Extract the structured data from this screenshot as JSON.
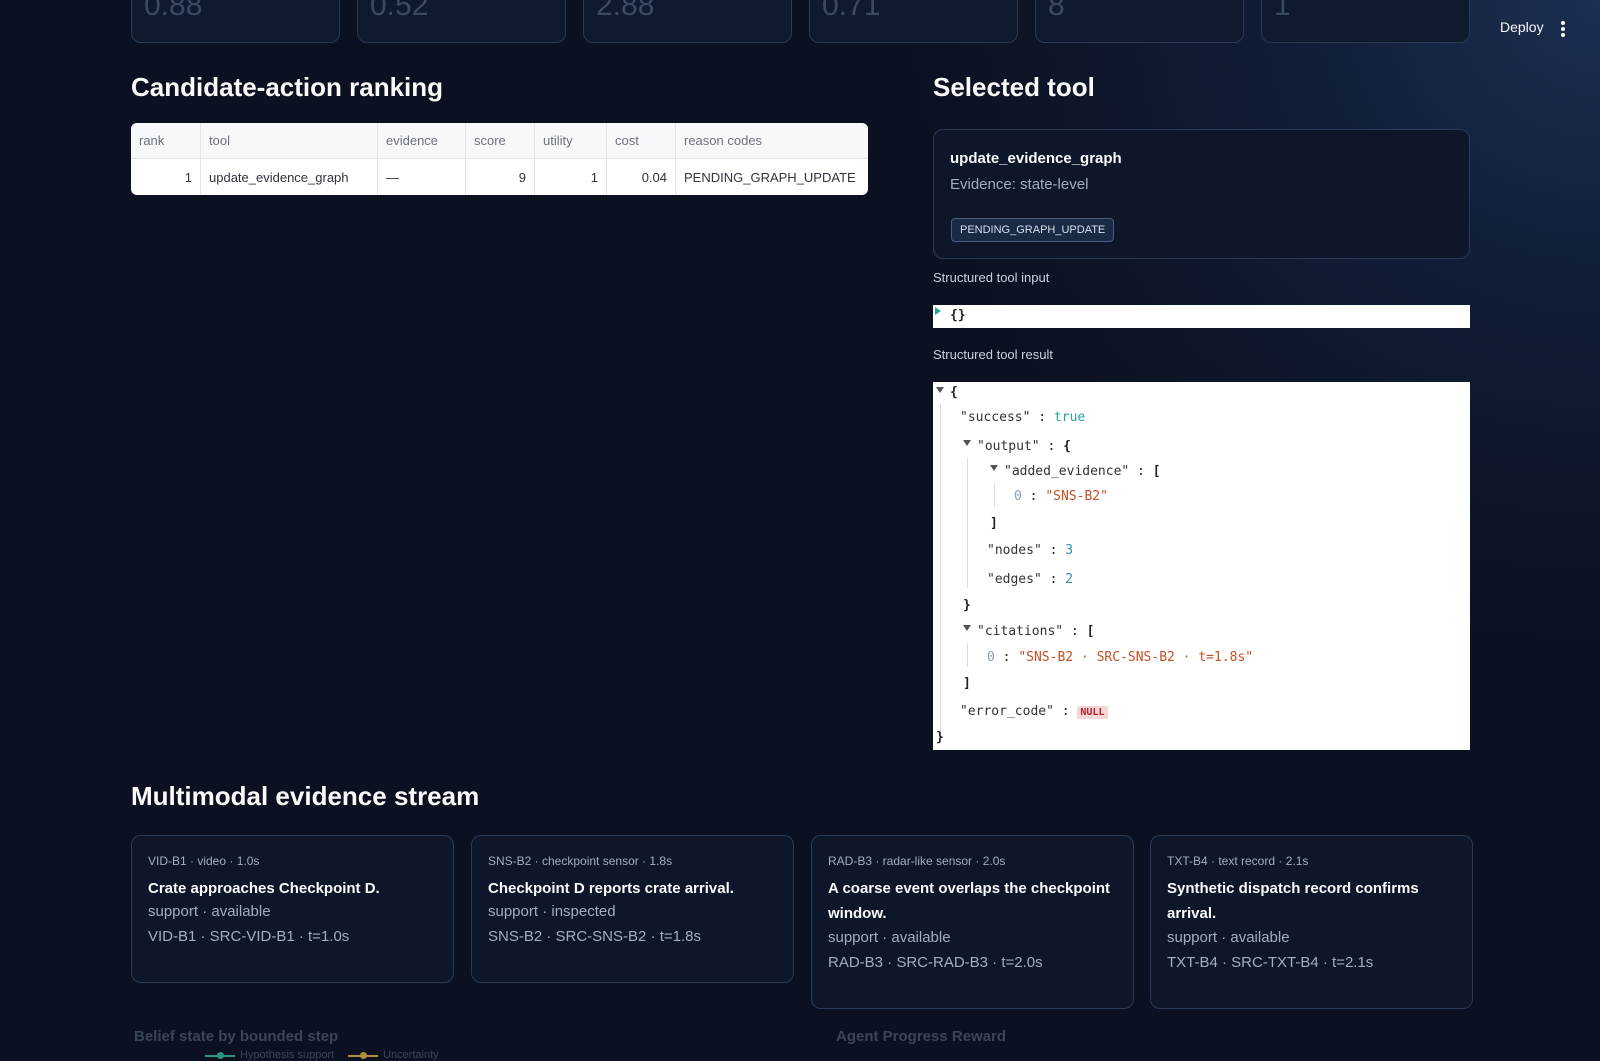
{
  "metrics": [
    "0.88",
    "0.52",
    "2.88",
    "0.71",
    "8",
    "1"
  ],
  "header": {
    "deploy_label": "Deploy"
  },
  "ranking": {
    "title": "Candidate-action ranking",
    "columns": [
      "rank",
      "tool",
      "evidence",
      "score",
      "utility",
      "cost",
      "reason codes"
    ],
    "rows": [
      [
        "1",
        "update_evidence_graph",
        "—",
        "9",
        "1",
        "0.04",
        "PENDING_GRAPH_UPDATE"
      ]
    ]
  },
  "selected_tool": {
    "title": "Selected tool",
    "name": "update_evidence_graph",
    "evidence": "Evidence: state-level",
    "badge": "PENDING_GRAPH_UPDATE",
    "input_label": "Structured tool input",
    "input_value": "{}",
    "result_label": "Structured tool result",
    "result": {
      "success_key": "\"success\"",
      "success_val": "true",
      "output_key": "\"output\"",
      "added_evidence_key": "\"added_evidence\"",
      "added_evidence_index": "0",
      "added_evidence_0": "\"SNS-B2\"",
      "nodes_key": "\"nodes\"",
      "nodes_val": "3",
      "edges_key": "\"edges\"",
      "edges_val": "2",
      "citations_key": "\"citations\"",
      "citations_index": "0",
      "citations_0": "\"SNS-B2 · SRC-SNS-B2 · t=1.8s\"",
      "error_code_key": "\"error_code\"",
      "error_code_val": "NULL"
    }
  },
  "evidence_stream": {
    "title": "Multimodal evidence stream",
    "cards": [
      {
        "meta": "VID-B1 · video · 1.0s",
        "title": "Crate approaches Checkpoint D.",
        "status": "support · available",
        "cite": "VID-B1 · SRC-VID-B1 · t=1.0s"
      },
      {
        "meta": "SNS-B2 · checkpoint sensor · 1.8s",
        "title": "Checkpoint D reports crate arrival.",
        "status": "support · inspected",
        "cite": "SNS-B2 · SRC-SNS-B2 · t=1.8s"
      },
      {
        "meta": "RAD-B3 · radar-like sensor · 2.0s",
        "title": "A coarse event overlaps the checkpoint window.",
        "status": "support · available",
        "cite": "RAD-B3 · SRC-RAD-B3 · t=2.0s"
      },
      {
        "meta": "TXT-B4 · text record · 2.1s",
        "title": "Synthetic dispatch record confirms arrival.",
        "status": "support · available",
        "cite": "TXT-B4 · SRC-TXT-B4 · t=2.1s"
      }
    ]
  },
  "bottom": {
    "belief_title": "Belief state by bounded step",
    "legend": [
      "Hypothesis support",
      "Uncertainty"
    ],
    "legend_colors": [
      "#2ec4a0",
      "#e8b84a"
    ],
    "reward_title": "Agent Progress Reward"
  }
}
